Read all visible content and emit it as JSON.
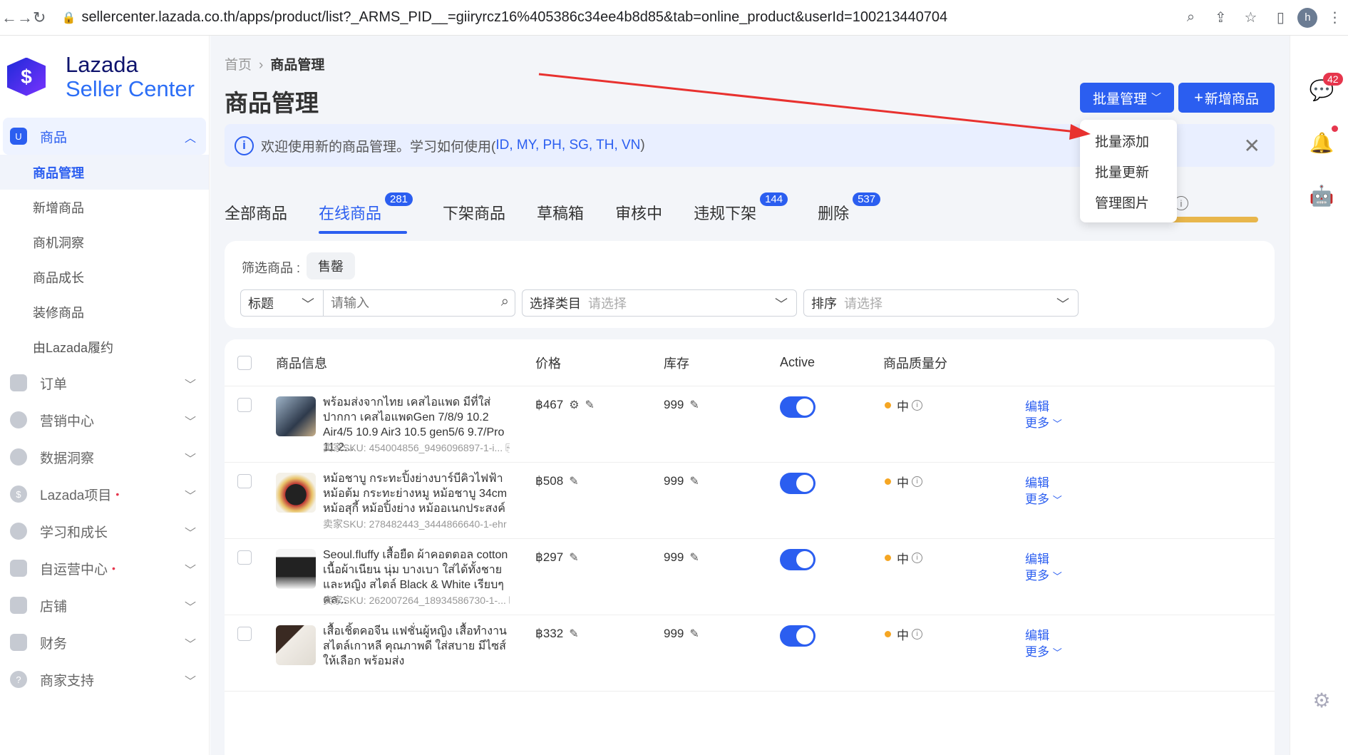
{
  "browser": {
    "url": "sellercenter.lazada.co.th/apps/product/list?_ARMS_PID__=giiryrcz16%405386c34ee4b8d85&tab=online_product&userId=100213440704",
    "profile_initial": "h"
  },
  "brand": {
    "line1": "Lazada",
    "line2": "Seller Center"
  },
  "sidebar": {
    "products_section": {
      "label": "商品",
      "items": [
        {
          "label": "商品管理"
        },
        {
          "label": "新增商品"
        },
        {
          "label": "商机洞察"
        },
        {
          "label": "商品成长"
        },
        {
          "label": "装修商品"
        },
        {
          "label": "由Lazada履约"
        }
      ]
    },
    "groups": [
      {
        "label": "订单",
        "dot": ""
      },
      {
        "label": "营销中心",
        "dot": ""
      },
      {
        "label": "数据洞察",
        "dot": ""
      },
      {
        "label": "Lazada项目",
        "dot": "•"
      },
      {
        "label": "学习和成长",
        "dot": ""
      },
      {
        "label": "自运营中心",
        "dot": "•"
      },
      {
        "label": "店铺",
        "dot": ""
      },
      {
        "label": "财务",
        "dot": ""
      },
      {
        "label": "商家支持",
        "dot": ""
      }
    ]
  },
  "header": {
    "breadcrumb_home": "首页",
    "breadcrumb_current": "商品管理",
    "title": "商品管理",
    "batch_button": "批量管理",
    "new_button": "新增商品"
  },
  "dropdown": {
    "items": [
      "批量添加",
      "批量更新",
      "管理图片"
    ]
  },
  "notice": {
    "text": "欢迎使用新的商品管理。学习如何使用(",
    "links": "ID, MY, PH, SG, TH, VN",
    "end": ")"
  },
  "tabs": [
    {
      "label": "全部商品",
      "badge": ""
    },
    {
      "label": "在线商品",
      "badge": "281"
    },
    {
      "label": "下架商品",
      "badge": ""
    },
    {
      "label": "草稿箱",
      "badge": ""
    },
    {
      "label": "审核中",
      "badge": ""
    },
    {
      "label": "违规下架",
      "badge": "144"
    },
    {
      "label": "删除",
      "badge": "537"
    }
  ],
  "filters": {
    "label": "筛选商品 :",
    "chip": "售罄",
    "title_select": "标题",
    "title_placeholder": "请输入",
    "category_label": "选择类目",
    "category_placeholder": "请选择",
    "sort_label": "排序",
    "sort_placeholder": "请选择"
  },
  "table": {
    "headers": {
      "info": "商品信息",
      "price": "价格",
      "stock": "库存",
      "active": "Active",
      "quality": "商品质量分"
    },
    "rows": [
      {
        "name": "พร้อมส่งจากไทย เคสไอแพด มีที่ใส่ปากกา เคสไอแพดGen 7/8/9 10.2 Air4/5 10.9 Air3 10.5 gen5/6 9.7/Pro 11 2...",
        "sku": "卖家SKU: 454004856_9496096897-1-i...",
        "price": "฿467",
        "stock": "999",
        "quality": "中",
        "edit": "编辑",
        "more": "更多"
      },
      {
        "name": "หม้อชาบู กระทะปิ้งย่างบาร์บีคิวไฟฟ้า หม้อต้ม กระทะย่างหมู หม้อชาบู 34cm หม้อสุกี้ หม้อปิ้งย่าง หม้ออเนกประสงค์",
        "sku": "卖家SKU: 278482443_3444866640-1-ehr",
        "price": "฿508",
        "stock": "999",
        "quality": "中",
        "edit": "编辑",
        "more": "更多"
      },
      {
        "name": "Seoul.fluffy เสื้อยืด ผ้าคอตตอล cotton เนื้อผ้าเนียน นุ่ม บางเบา ใส่ได้ทั้งชายและหญิง สไตล์ Black & White เรียบๆ คล...",
        "sku": "卖家SKU: 262007264_18934586730-1-...",
        "price": "฿297",
        "stock": "999",
        "quality": "中",
        "edit": "编辑",
        "more": "更多"
      },
      {
        "name": "เสื้อเชิ้ตคอจีน แฟชั่นผู้หญิง เสื้อทำงาน สไตล์เกาหลี คุณภาพดี ใส่สบาย มีไซส์ให้เลือก พร้อมส่ง",
        "sku": "",
        "price": "฿332",
        "stock": "999",
        "quality": "中",
        "edit": "编辑",
        "more": "更多"
      }
    ]
  },
  "rail": {
    "chat_badge": "42"
  },
  "colors": {
    "primary": "#2b5ef0",
    "annotation_arrow": "#e8312f",
    "quality_dot": "#f5a623"
  }
}
